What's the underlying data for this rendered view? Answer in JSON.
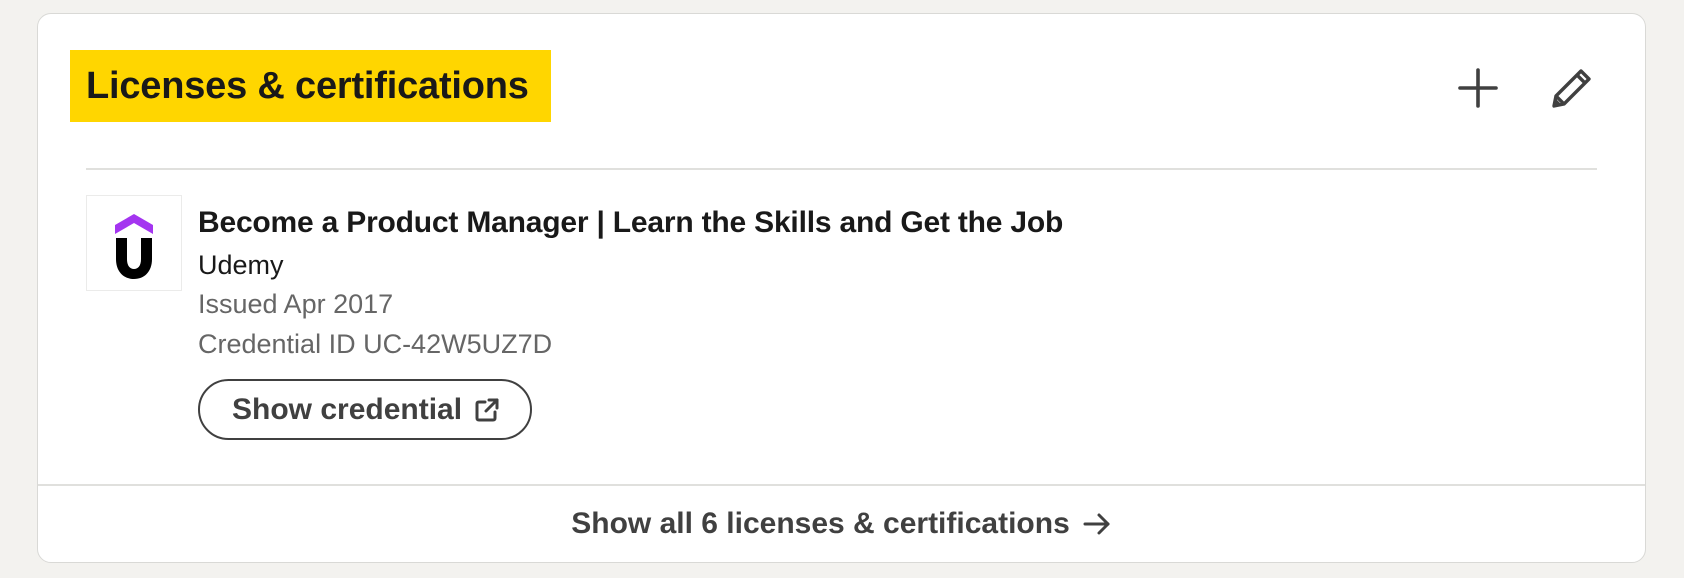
{
  "section": {
    "title": "Licenses & certifications",
    "highlight_color": "#ffd600",
    "actions": {
      "add_icon": "plus-icon",
      "edit_icon": "pencil-icon"
    }
  },
  "certification": {
    "logo": {
      "icon": "udemy-logo",
      "letter": "U",
      "accent_color": "#a435f0"
    },
    "title": "Become a Product Manager | Learn the Skills and Get the Job",
    "issuer": "Udemy",
    "issued": "Issued Apr 2017",
    "credential_id": "Credential ID UC-42W5UZ7D",
    "show_credential_label": "Show credential",
    "show_credential_icon": "external-link-icon"
  },
  "footer": {
    "show_all_label": "Show all 6 licenses & certifications",
    "arrow_icon": "arrow-right-icon"
  }
}
